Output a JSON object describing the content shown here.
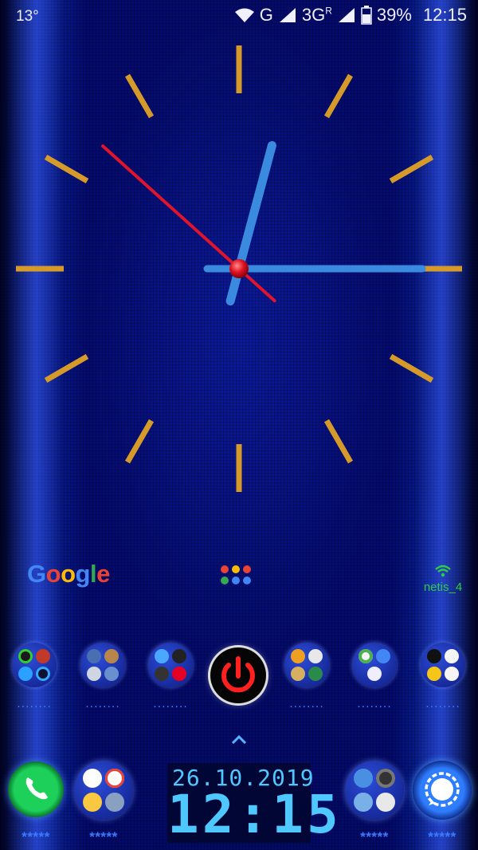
{
  "status_bar": {
    "temperature": "13°",
    "network_1": "G",
    "network_2": "3G",
    "network_2_suffix": "R",
    "battery": "39%",
    "time": "12:15"
  },
  "analog_clock": {
    "hour": 12,
    "minute": 2,
    "second": 52,
    "marker_color": "#d69a2a",
    "second_hand_color": "#e0142a",
    "hand_color": "#3a8be0"
  },
  "home": {
    "google_letters": [
      "G",
      "o",
      "o",
      "g",
      "l",
      "e"
    ],
    "wifi_ssid": "netis_4",
    "folder_labels": [
      "........",
      "........",
      "........",
      "........",
      "........",
      "........"
    ],
    "dock_labels": [
      "*****",
      "*****",
      "*****",
      "*****"
    ],
    "up_arrow": "^"
  },
  "digital_clock": {
    "date": "26.10.2019",
    "time": "12:15"
  },
  "colors": {
    "accent_blue": "#3a7bff",
    "digital_cyan": "#4fc8ff",
    "phone_green": "#1dd05a",
    "wifi_green": "#2ecc40",
    "power_red": "#ff2020"
  }
}
